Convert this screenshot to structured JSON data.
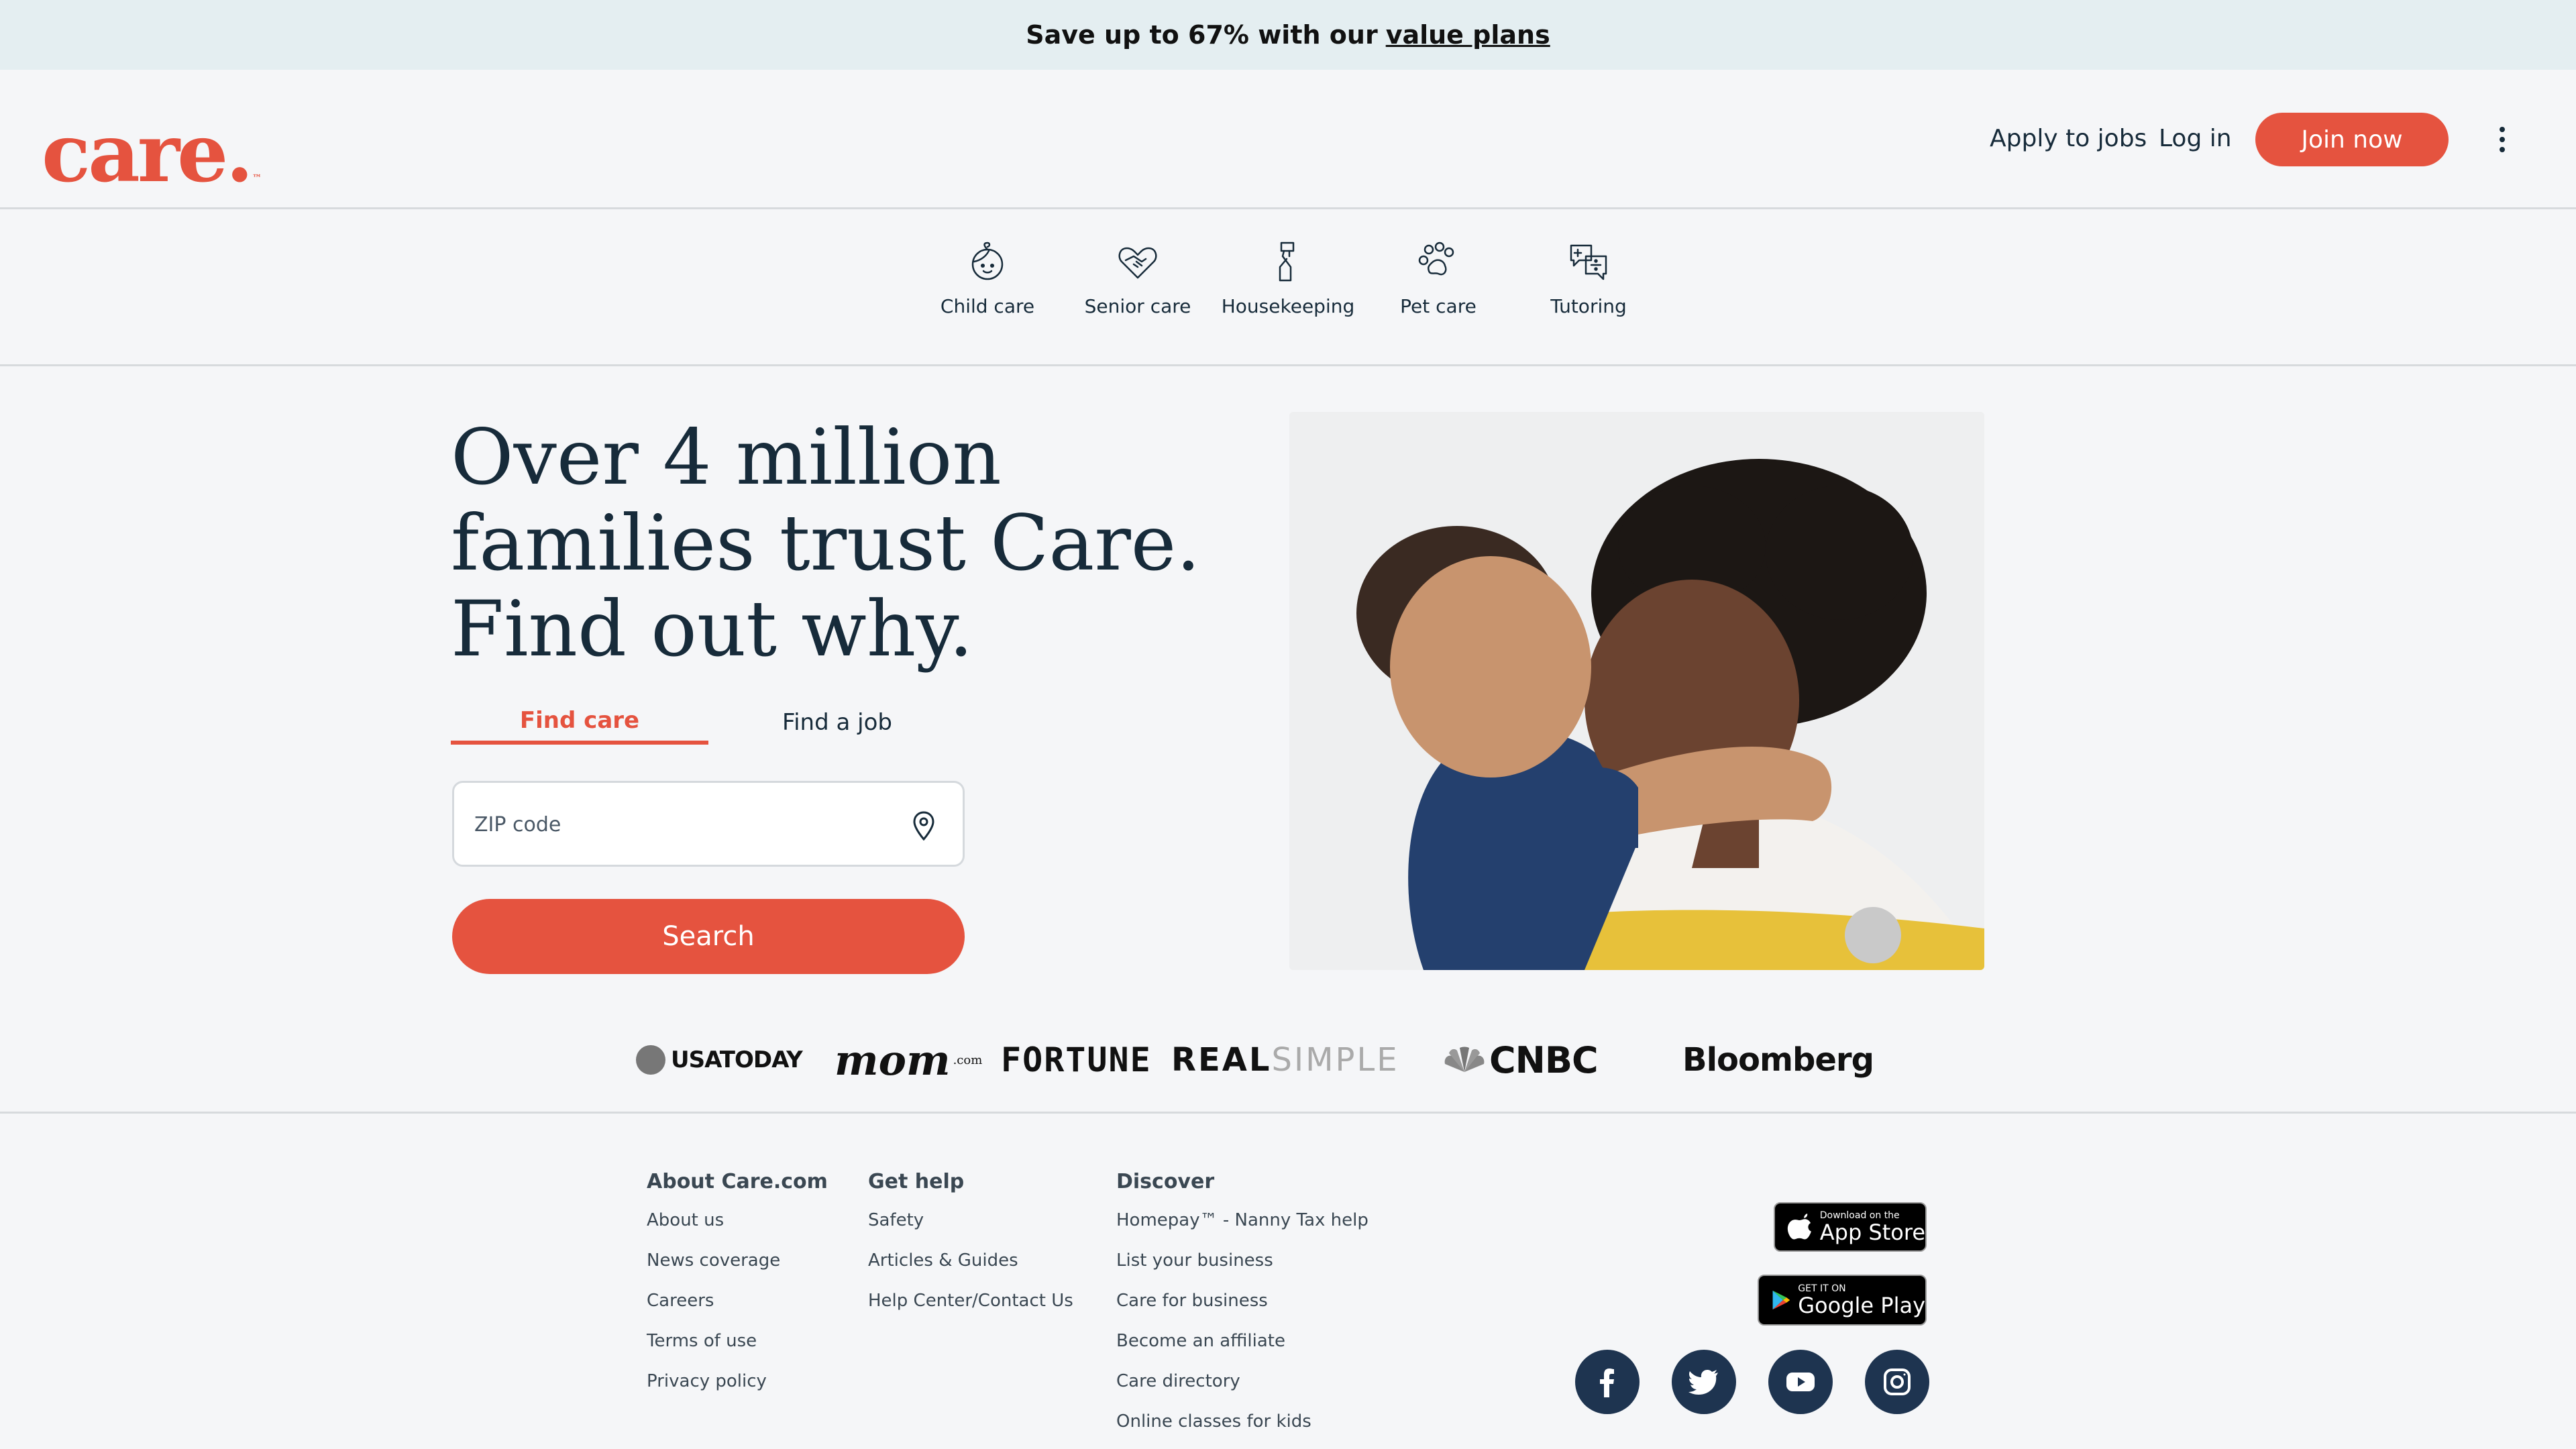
{
  "promo": {
    "text": "Save up to 67% with our",
    "link": "value plans"
  },
  "header": {
    "logo": "care.",
    "logo_tm": "™",
    "apply_label": "Apply to jobs",
    "login_label": "Log in",
    "join_label": "Join now"
  },
  "categories": [
    {
      "label": "Child care",
      "icon": "child-face-icon"
    },
    {
      "label": "Senior care",
      "icon": "heart-hands-icon"
    },
    {
      "label": "Housekeeping",
      "icon": "spray-bottle-icon"
    },
    {
      "label": "Pet care",
      "icon": "paw-icon"
    },
    {
      "label": "Tutoring",
      "icon": "math-bubble-icon"
    }
  ],
  "hero": {
    "headline_lines": [
      "Over 4 million",
      "families trust Care.",
      "Find out why."
    ],
    "tab_find_care": "Find care",
    "tab_find_job": "Find a job",
    "zip_placeholder": "ZIP code",
    "search_label": "Search"
  },
  "press": {
    "usatoday": "USATODAY",
    "mom": "mom",
    "mom_suffix": ".com",
    "fortune": "FORTUNE",
    "real": "REAL",
    "simple": "SIMPLE",
    "cnbc": "CNBC",
    "bloomberg": "Bloomberg"
  },
  "footer": {
    "about": {
      "heading": "About Care.com",
      "links": [
        "About us",
        "News coverage",
        "Careers",
        "Terms of use",
        "Privacy policy"
      ]
    },
    "help": {
      "heading": "Get help",
      "links": [
        "Safety",
        "Articles & Guides",
        "Help Center/Contact Us"
      ]
    },
    "discover": {
      "heading": "Discover",
      "links": [
        "Homepay™ - Nanny Tax help",
        "List your business",
        "Care for business",
        "Become an affiliate",
        "Care directory",
        "Online classes for kids"
      ]
    },
    "appstore_small": "Download on the",
    "appstore_big": "App Store",
    "googleplay_small": "GET IT ON",
    "googleplay_big": "Google Play",
    "social": [
      "facebook-icon",
      "twitter-icon",
      "youtube-icon",
      "instagram-icon"
    ]
  },
  "colors": {
    "brand": "#e5533f",
    "text": "#172b3a",
    "banner": "#e4eef1",
    "social": "#1e3450"
  }
}
